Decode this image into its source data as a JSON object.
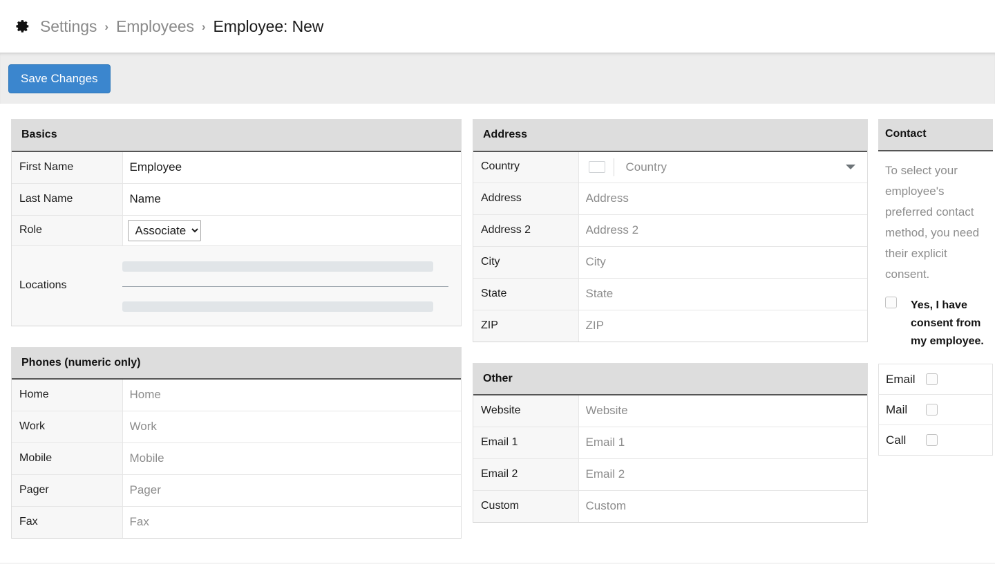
{
  "breadcrumb": {
    "gear_icon": "gear-icon",
    "items": [
      {
        "label": "Settings",
        "current": false
      },
      {
        "label": "Employees",
        "current": false
      },
      {
        "label": "Employee: New",
        "current": true
      }
    ],
    "separator": "›"
  },
  "toolbar": {
    "save_label": "Save Changes",
    "accent_color": "#3b86ce"
  },
  "basics": {
    "title": "Basics",
    "first_name": {
      "label": "First Name",
      "value": "Employee",
      "placeholder": "First Name"
    },
    "last_name": {
      "label": "Last Name",
      "value": "Name",
      "placeholder": "Last Name"
    },
    "role": {
      "label": "Role",
      "value": "Associate",
      "options": [
        "Associate"
      ]
    },
    "locations": {
      "label": "Locations"
    }
  },
  "phones": {
    "title": "Phones (numeric only)",
    "rows": [
      {
        "label": "Home",
        "value": "",
        "placeholder": "Home"
      },
      {
        "label": "Work",
        "value": "",
        "placeholder": "Work"
      },
      {
        "label": "Mobile",
        "value": "",
        "placeholder": "Mobile"
      },
      {
        "label": "Pager",
        "value": "",
        "placeholder": "Pager"
      },
      {
        "label": "Fax",
        "value": "",
        "placeholder": "Fax"
      }
    ]
  },
  "address": {
    "title": "Address",
    "country": {
      "label": "Country",
      "placeholder": "Country",
      "caret": "chevron-down-icon"
    },
    "rows": [
      {
        "label": "Address",
        "value": "",
        "placeholder": "Address"
      },
      {
        "label": "Address 2",
        "value": "",
        "placeholder": "Address 2"
      },
      {
        "label": "City",
        "value": "",
        "placeholder": "City"
      },
      {
        "label": "State",
        "value": "",
        "placeholder": "State"
      },
      {
        "label": "ZIP",
        "value": "",
        "placeholder": "ZIP"
      }
    ]
  },
  "other": {
    "title": "Other",
    "rows": [
      {
        "label": "Website",
        "value": "",
        "placeholder": "Website"
      },
      {
        "label": "Email 1",
        "value": "",
        "placeholder": "Email 1"
      },
      {
        "label": "Email 2",
        "value": "",
        "placeholder": "Email 2"
      },
      {
        "label": "Custom",
        "value": "",
        "placeholder": "Custom"
      }
    ]
  },
  "contact": {
    "title": "Contact",
    "note": "To select your employee's preferred contact method, you need their explicit consent.",
    "consent_label": "Yes, I have consent from my employee.",
    "preferences": [
      {
        "label": "Email",
        "checked": false
      },
      {
        "label": "Mail",
        "checked": false
      },
      {
        "label": "Call",
        "checked": false
      }
    ]
  }
}
